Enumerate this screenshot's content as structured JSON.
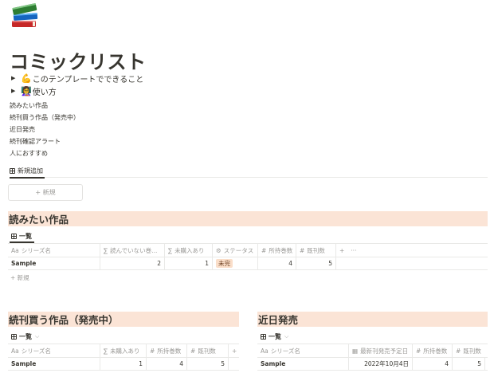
{
  "page": {
    "icon": "books-icon",
    "title": "コミックリスト",
    "toggles": [
      {
        "emoji": "💪",
        "label": "このテンプレートでできること"
      },
      {
        "emoji": "👩‍🏫",
        "label": "使い方"
      }
    ],
    "links": [
      "読みたい作品",
      "続刊買う作品（発売中）",
      "近日発売",
      "続刊確認アラート",
      "人におすすめ"
    ],
    "tab": {
      "label": "新規追加"
    },
    "new_button": "+ 新規"
  },
  "section_want": {
    "title": "読みたい作品",
    "view_label": "一覧",
    "columns": [
      {
        "icon": "Aa",
        "label": "シリーズ名"
      },
      {
        "icon": "∑",
        "label": "読んでいない巻..."
      },
      {
        "icon": "∑",
        "label": "未購入あり"
      },
      {
        "icon": "⚙",
        "label": "ステータス"
      },
      {
        "icon": "#",
        "label": "所持巻数"
      },
      {
        "icon": "#",
        "label": "既刊数"
      }
    ],
    "tools": {
      "add": "+",
      "more": "···"
    },
    "row": {
      "name": "Sample",
      "unread": "2",
      "unpurchased": "1",
      "status": "未完",
      "owned": "4",
      "published": "5"
    },
    "new_row": "+ 新規"
  },
  "section_buy": {
    "title": "続刊買う作品（発売中）",
    "view_label": "一覧",
    "columns": [
      {
        "icon": "Aa",
        "label": "シリーズ名"
      },
      {
        "icon": "∑",
        "label": "未購入あり"
      },
      {
        "icon": "#",
        "label": "所持巻数"
      },
      {
        "icon": "#",
        "label": "既刊数"
      }
    ],
    "add": "+",
    "row": {
      "name": "Sample",
      "unpurchased": "1",
      "owned": "4",
      "published": "5"
    }
  },
  "section_soon": {
    "title": "近日発売",
    "view_label": "一覧",
    "columns": [
      {
        "icon": "Aa",
        "label": "シリーズ名"
      },
      {
        "icon": "▦",
        "label": "最新刊発売予定日"
      },
      {
        "icon": "#",
        "label": "所持巻数"
      },
      {
        "icon": "#",
        "label": "既刊数"
      }
    ],
    "row": {
      "name": "Sample",
      "date": "2022年10月4日",
      "owned": "4",
      "published": "5"
    }
  }
}
